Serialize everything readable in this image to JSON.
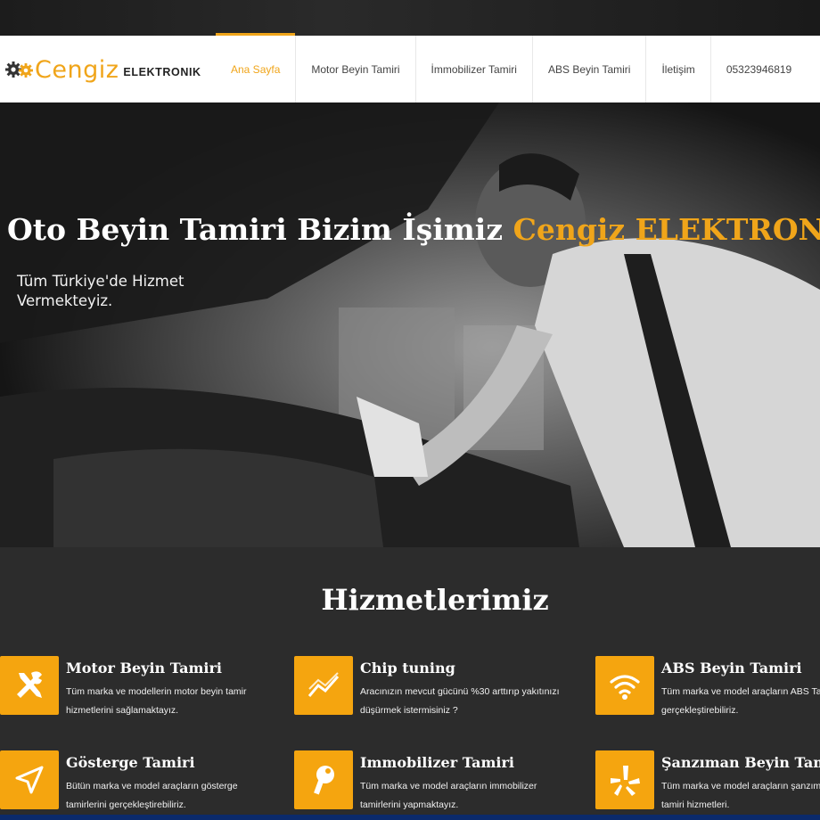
{
  "brand": {
    "name": "Cengiz",
    "sub": "ELEKTRONIK",
    "accent": "#f0a51a"
  },
  "nav": {
    "items": [
      {
        "label": "Ana Sayfa",
        "active": true
      },
      {
        "label": "Motor Beyin Tamiri"
      },
      {
        "label": "İmmobilizer Tamiri"
      },
      {
        "label": "ABS Beyin Tamiri"
      },
      {
        "label": "İletişim"
      },
      {
        "label": "05323946819"
      }
    ]
  },
  "hero": {
    "title_main": "Oto Beyin Tamiri Bizim İşimiz ",
    "title_accent": "Cengiz ELEKTRONİK",
    "subtitle": "Tüm Türkiye'de Hizmet Vermekteyiz."
  },
  "services": {
    "title": "Hizmetlerimiz",
    "items": [
      {
        "title": "Motor Beyin Tamiri",
        "desc": "Tüm marka ve modellerin motor beyin tamir hizmetlerini sağlamaktayız.",
        "icon": "tools-icon"
      },
      {
        "title": "Chip tuning",
        "desc": "Aracınızın mevcut gücünü %30 arttırıp yakıtınızı düşürmek istermisiniz ?",
        "icon": "chart-line-icon"
      },
      {
        "title": "ABS Beyin Tamiri",
        "desc": "Tüm marka ve model araçların ABS Tamirini gerçekleştirebiliriz.",
        "icon": "wifi-icon"
      },
      {
        "title": "Gösterge Tamiri",
        "desc": "Bütün marka ve model araçların gösterge tamirlerini gerçekleştirebiliriz.",
        "icon": "location-arrow-icon"
      },
      {
        "title": "Immobilizer Tamiri",
        "desc": "Tüm marka ve model araçların immobilizer tamirlerini yapmaktayız.",
        "icon": "key-icon"
      },
      {
        "title": "Şanzıman Beyin Tamiri",
        "desc": "Tüm marka ve model araçların şanzıman beyin tamiri hizmetleri.",
        "icon": "yelp-icon"
      }
    ]
  }
}
